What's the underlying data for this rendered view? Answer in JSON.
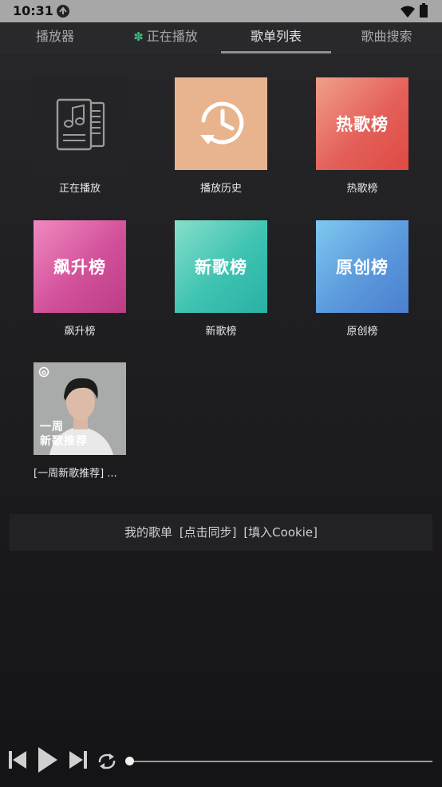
{
  "status_bar": {
    "time": "10:31",
    "icons": [
      "app-notification-icon",
      "wifi-icon",
      "battery-icon"
    ]
  },
  "tabs": [
    {
      "label": "播放器",
      "active": false
    },
    {
      "label": "正在播放",
      "active": false,
      "icon": "clover-icon"
    },
    {
      "label": "歌单列表",
      "active": true
    },
    {
      "label": "歌曲搜索",
      "active": false
    }
  ],
  "grid": [
    {
      "caption": "正在播放",
      "art_text": "",
      "art_icon": "playlist-document-icon"
    },
    {
      "caption": "播放历史",
      "art_text": "",
      "art_icon": "history-clock-icon"
    },
    {
      "caption": "热歌榜",
      "art_text": "热歌榜"
    },
    {
      "caption": "飙升榜",
      "art_text": "飙升榜"
    },
    {
      "caption": "新歌榜",
      "art_text": "新歌榜"
    },
    {
      "caption": "原创榜",
      "art_text": "原创榜"
    },
    {
      "caption": "[一周新歌推荐] ...",
      "art_text_line1": "一周",
      "art_text_line2": "新歌推荐",
      "art_icon": "netease-cloud-music-icon"
    }
  ],
  "my_playlists": {
    "label": "我的歌单",
    "sync": "[点击同步]",
    "cookie": "[填入Cookie]"
  },
  "player": {
    "progress": 0.0,
    "controls": [
      "previous-icon",
      "play-icon",
      "next-icon",
      "repeat-icon"
    ]
  },
  "colors": {
    "hot": "#e4605a",
    "soar": "#d2509a",
    "new": "#3ec2b1",
    "orig": "#5b99dc",
    "history": "#e7b48e",
    "accent_clover": "#3fb47a"
  }
}
